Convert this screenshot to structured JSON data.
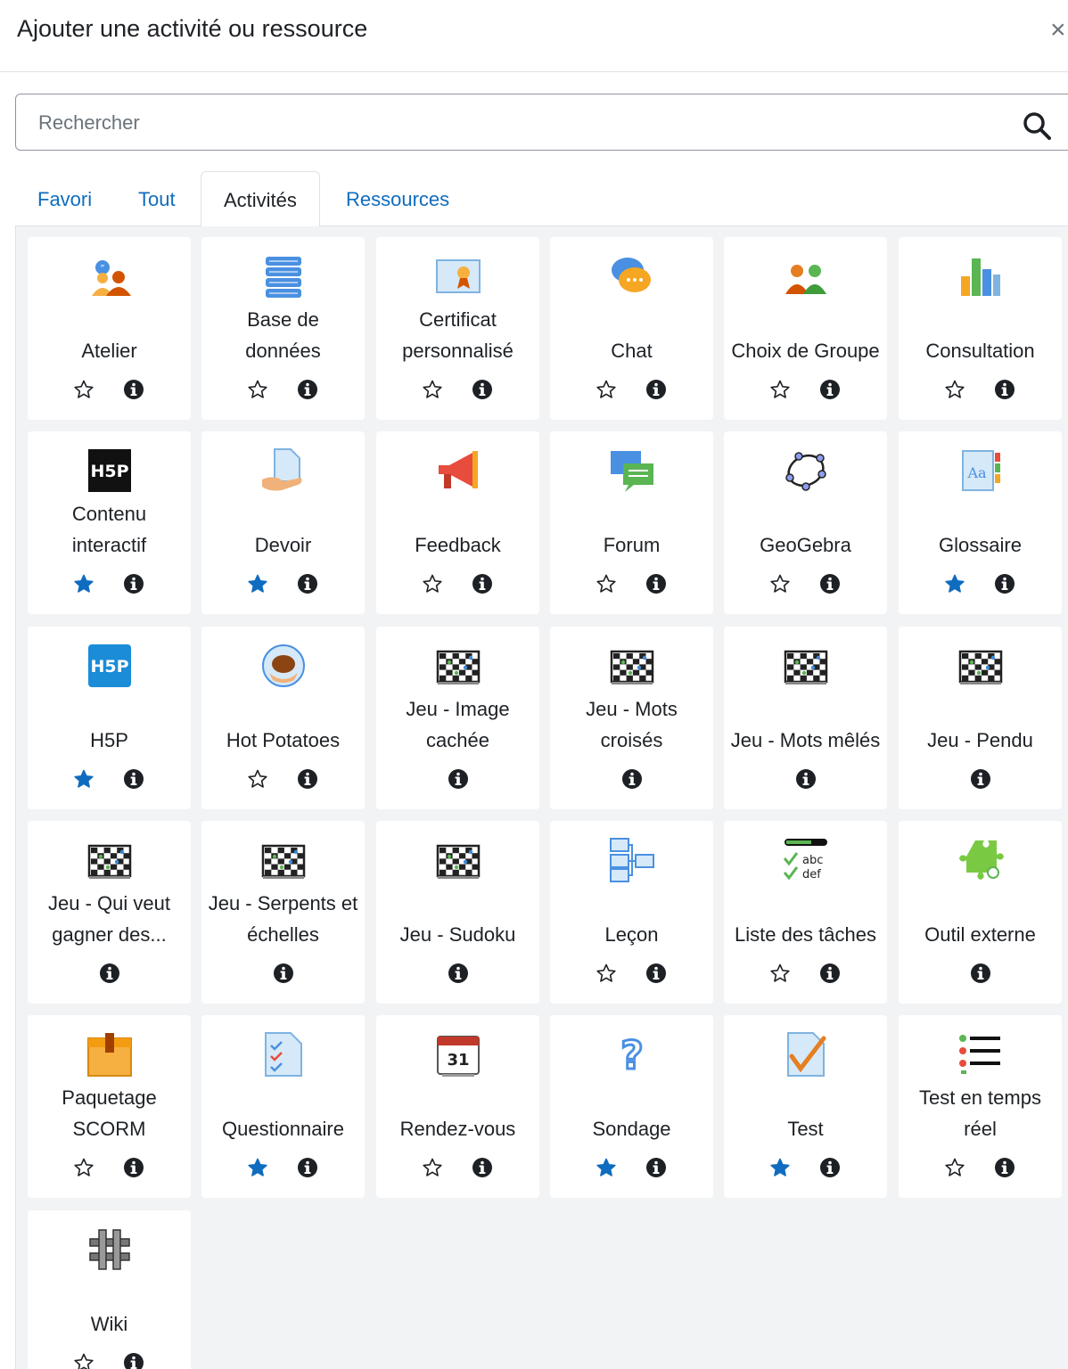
{
  "modal": {
    "title": "Ajouter une activité ou ressource",
    "close_glyph": "×"
  },
  "search": {
    "placeholder": "Rechercher"
  },
  "tabs": [
    {
      "label": "Favori",
      "active": false
    },
    {
      "label": "Tout",
      "active": false
    },
    {
      "label": "Activités",
      "active": true
    },
    {
      "label": "Ressources",
      "active": false
    }
  ],
  "colors": {
    "link": "#0f6cbf",
    "star_filled": "#0f6cbf",
    "grid_bg": "#f2f3f5"
  },
  "activities": [
    {
      "name": "Atelier",
      "icon": "workshop-icon",
      "star": "empty"
    },
    {
      "name": "Base de données",
      "icon": "database-icon",
      "star": "empty"
    },
    {
      "name": "Certificat personnalisé",
      "icon": "certificate-icon",
      "star": "empty"
    },
    {
      "name": "Chat",
      "icon": "chat-icon",
      "star": "empty"
    },
    {
      "name": "Choix de Groupe",
      "icon": "group-choice-icon",
      "star": "empty"
    },
    {
      "name": "Consultation",
      "icon": "bar-chart-icon",
      "star": "empty"
    },
    {
      "name": "Contenu interactif",
      "icon": "h5p-dark-icon",
      "star": "filled"
    },
    {
      "name": "Devoir",
      "icon": "assignment-icon",
      "star": "filled"
    },
    {
      "name": "Feedback",
      "icon": "megaphone-icon",
      "star": "empty"
    },
    {
      "name": "Forum",
      "icon": "forum-icon",
      "star": "empty"
    },
    {
      "name": "GeoGebra",
      "icon": "geogebra-icon",
      "star": "empty"
    },
    {
      "name": "Glossaire",
      "icon": "glossary-icon",
      "star": "filled"
    },
    {
      "name": "H5P",
      "icon": "h5p-blue-icon",
      "star": "filled"
    },
    {
      "name": "Hot Potatoes",
      "icon": "hot-potatoes-icon",
      "star": "empty"
    },
    {
      "name": "Jeu - Image cachée",
      "icon": "game-board-icon",
      "star": "none"
    },
    {
      "name": "Jeu - Mots croisés",
      "icon": "game-board-icon",
      "star": "none"
    },
    {
      "name": "Jeu - Mots mêlés",
      "icon": "game-board-icon",
      "star": "none"
    },
    {
      "name": "Jeu - Pendu",
      "icon": "game-board-icon",
      "star": "none"
    },
    {
      "name": "Jeu - Qui veut gagner des...",
      "icon": "game-board-icon",
      "star": "none"
    },
    {
      "name": "Jeu - Serpents et échelles",
      "icon": "game-board-icon",
      "star": "none"
    },
    {
      "name": "Jeu - Sudoku",
      "icon": "game-board-icon",
      "star": "none"
    },
    {
      "name": "Leçon",
      "icon": "lesson-icon",
      "star": "empty"
    },
    {
      "name": "Liste des tâches",
      "icon": "checklist-icon",
      "star": "empty",
      "icon_text": [
        "abc",
        "def"
      ]
    },
    {
      "name": "Outil externe",
      "icon": "puzzle-icon",
      "star": "none"
    },
    {
      "name": "Paquetage SCORM",
      "icon": "scorm-package-icon",
      "star": "empty"
    },
    {
      "name": "Questionnaire",
      "icon": "questionnaire-icon",
      "star": "filled"
    },
    {
      "name": "Rendez-vous",
      "icon": "calendar-icon",
      "star": "empty",
      "icon_text": [
        "31"
      ]
    },
    {
      "name": "Sondage",
      "icon": "question-mark-icon",
      "star": "filled"
    },
    {
      "name": "Test",
      "icon": "quiz-icon",
      "star": "filled"
    },
    {
      "name": "Test en temps réel",
      "icon": "realtime-quiz-icon",
      "star": "empty"
    },
    {
      "name": "Wiki",
      "icon": "wiki-icon",
      "star": "empty"
    }
  ]
}
